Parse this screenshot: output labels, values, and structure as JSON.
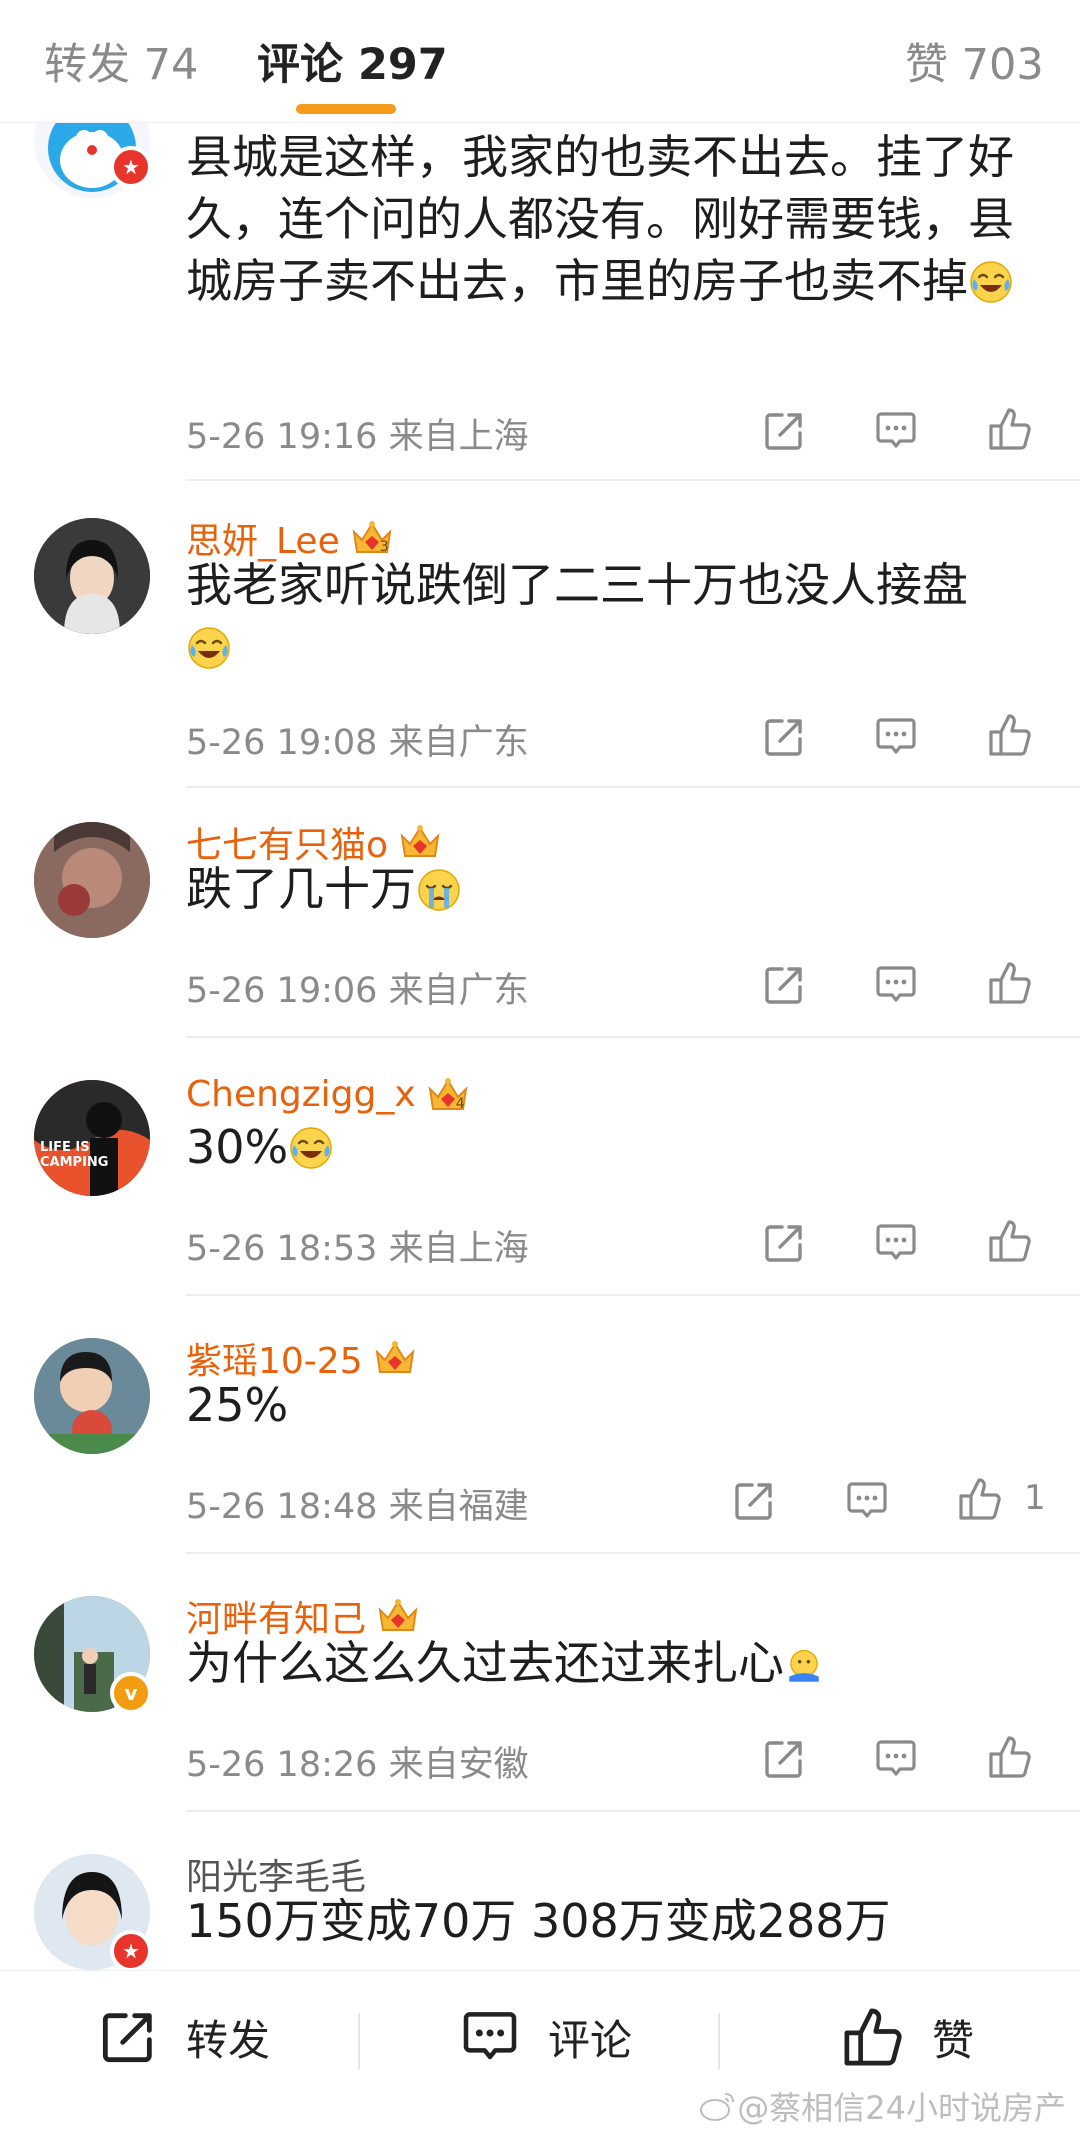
{
  "tabs": {
    "repost": "转发 74",
    "comments": "评论 297",
    "likes": "赞 703"
  },
  "comments": [
    {
      "name": "",
      "text": "县城是这样，我家的也卖不出去。挂了好久，连个问的人都没有。刚好需要钱，县城房子卖不出去，市里的房子也卖不掉",
      "time": "5-26 19:16",
      "location": "来自上海",
      "likes": ""
    },
    {
      "name": "思妍_Lee",
      "text": "我老家听说跌倒了二三十万也没人接盘",
      "time": "5-26 19:08",
      "location": "来自广东",
      "likes": ""
    },
    {
      "name": "七七有只猫o",
      "text": "跌了几十万",
      "time": "5-26 19:06",
      "location": "来自广东",
      "likes": ""
    },
    {
      "name": "Chengzigg_x",
      "text": "30%",
      "time": "5-26 18:53",
      "location": "来自上海",
      "likes": ""
    },
    {
      "name": "紫瑶10-25",
      "text": "25%",
      "time": "5-26 18:48",
      "location": "来自福建",
      "likes": "1"
    },
    {
      "name": "河畔有知己",
      "text": "为什么这么久过去还过来扎心",
      "time": "5-26 18:26",
      "location": "来自安徽",
      "likes": ""
    },
    {
      "name": "阳光李毛毛",
      "text": "150万变成70万 308万变成288万",
      "time": "",
      "location": "",
      "likes": ""
    }
  ],
  "avatar_text": {
    "chengzi_line1": "LIFE IS",
    "chengzi_line2": "CAMPING"
  },
  "crown_levels": [
    "3",
    "",
    "4",
    "",
    ""
  ],
  "badges": {
    "red": "★",
    "orange": "v"
  },
  "bottom_bar": {
    "repost": "转发",
    "comment": "评论",
    "like": "赞"
  },
  "watermark": "@蔡相信24小时说房产",
  "icons": [
    "repost-icon",
    "comment-icon",
    "like-icon",
    "crown-icon",
    "laugh-cry-emoji",
    "crying-emoji",
    "weibo-icon"
  ],
  "colors": {
    "accent": "#f59a1a",
    "username": "#e8620c",
    "meta": "#8a8a8a",
    "text": "#1e1e1e"
  }
}
